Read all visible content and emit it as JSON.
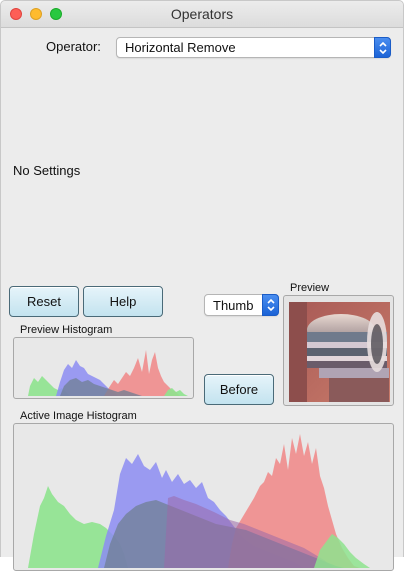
{
  "window": {
    "title": "Operators"
  },
  "operator": {
    "label": "Operator:",
    "value": "Horizontal Remove"
  },
  "settings": {
    "message": "No Settings"
  },
  "buttons": {
    "reset": "Reset",
    "help": "Help",
    "before": "Before"
  },
  "preview_mode": {
    "value": "Thumb"
  },
  "preview": {
    "label": "Preview"
  },
  "preview_histogram": {
    "label": "Preview Histogram"
  },
  "active_histogram": {
    "label": "Active Image Histogram"
  },
  "colors": {
    "red_channel": "#f08c8c",
    "green_channel": "#8ee38e",
    "blue_channel": "#8c8cf2",
    "overlap": "#6f7f93",
    "accent": "#1b63d6"
  },
  "icons": {
    "stepper": "up-down-chevron-icon"
  }
}
